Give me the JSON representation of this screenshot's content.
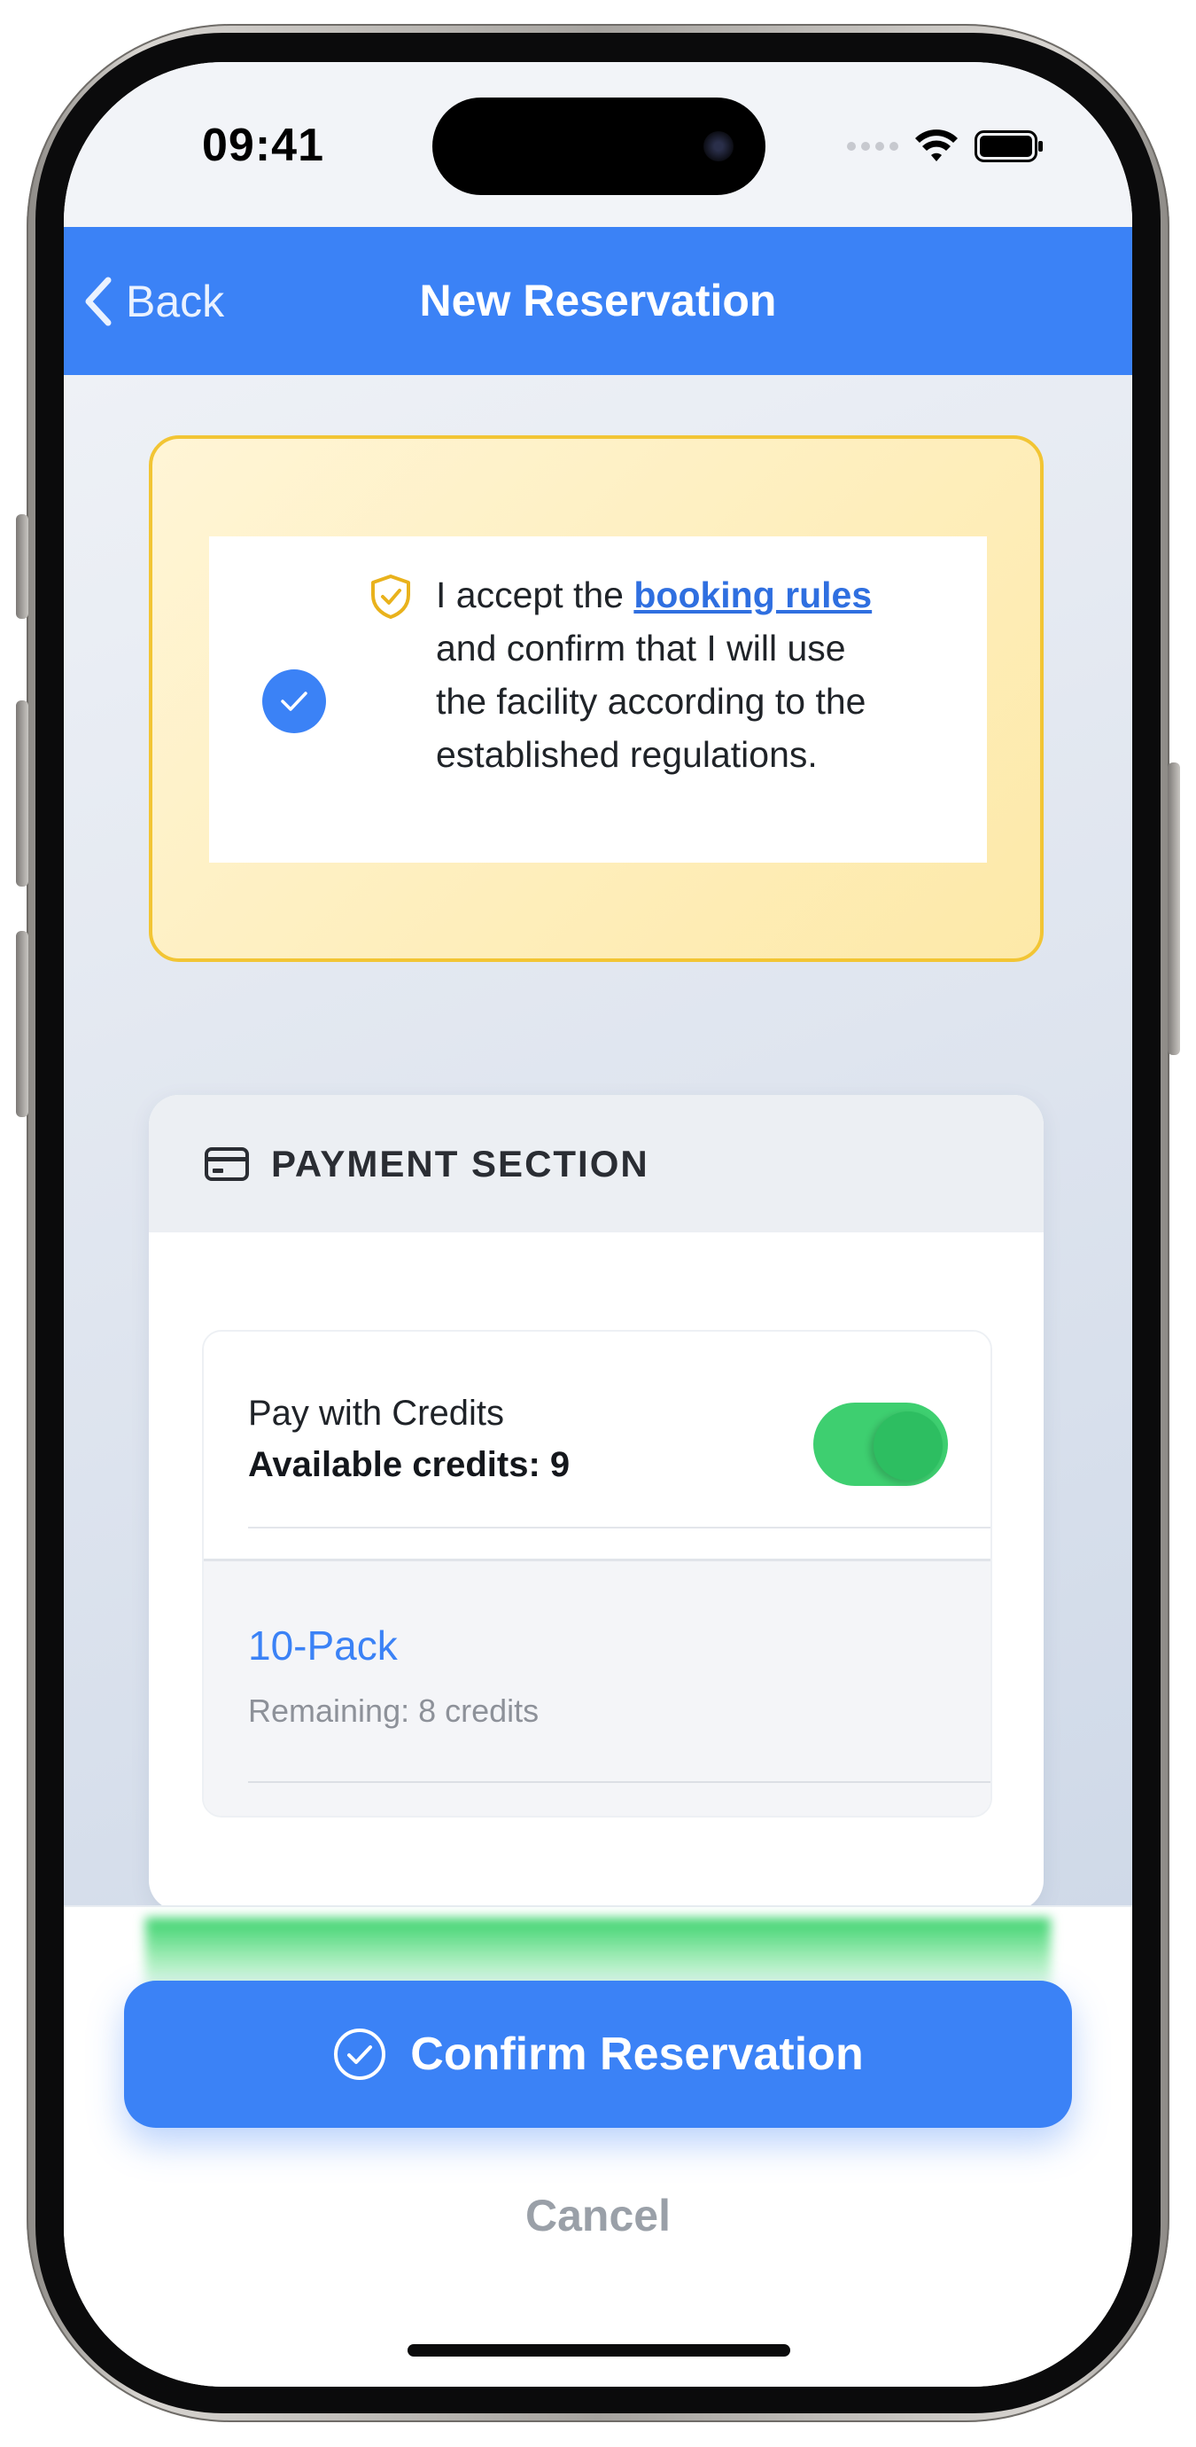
{
  "status_bar": {
    "time": "09:41"
  },
  "nav": {
    "back_label": "Back",
    "title": "New Reservation"
  },
  "rules": {
    "accepted": true,
    "text_before_link": "I accept the ",
    "link_text": "booking rules",
    "text_after_link": " and confirm that I will use the facility according to the established regulations."
  },
  "payment": {
    "section_title": "PAYMENT SECTION",
    "pay_with_credits_label": "Pay with Credits",
    "available_credits_text": "Available credits: 9",
    "pay_with_credits_enabled": true,
    "pack": {
      "name": "10-Pack",
      "remaining_text": "Remaining: 8 credits"
    }
  },
  "actions": {
    "confirm_label": "Confirm Reservation",
    "cancel_label": "Cancel"
  },
  "colors": {
    "primary": "#3b82f6",
    "rules_border": "#f2c534",
    "toggle_on": "#3ecf70"
  },
  "icons": {
    "back": "chevron-left-icon",
    "rules": "shield-check-icon",
    "accepted": "check-icon",
    "payment": "credit-card-icon",
    "confirm": "check-circle-icon"
  }
}
